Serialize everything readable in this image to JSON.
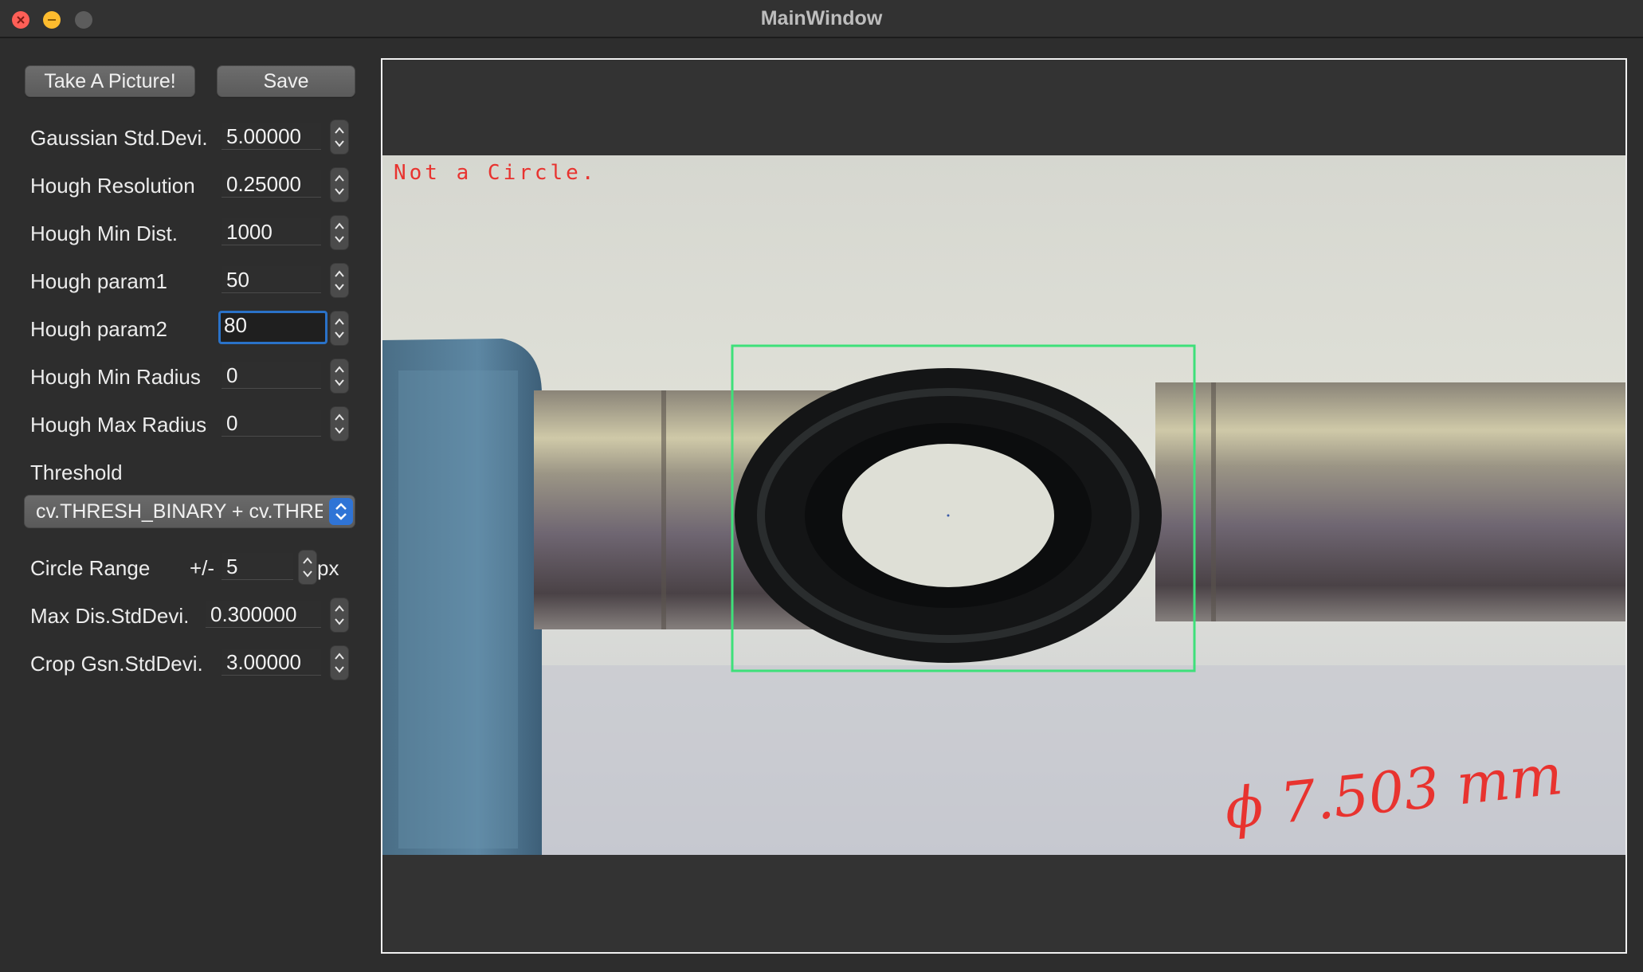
{
  "window": {
    "title": "MainWindow"
  },
  "toolbar": {
    "take_picture_label": "Take A Picture!",
    "save_label": "Save"
  },
  "params": [
    {
      "label": "Gaussian Std.Devi.",
      "value": "5.00000"
    },
    {
      "label": "Hough Resolution",
      "value": "0.25000"
    },
    {
      "label": "Hough Min Dist.",
      "value": "1000"
    },
    {
      "label": "Hough param1",
      "value": "50"
    },
    {
      "label": "Hough param2",
      "value": "80"
    },
    {
      "label": "Hough Min Radius",
      "value": "0"
    },
    {
      "label": "Hough Max Radius",
      "value": "0"
    }
  ],
  "threshold": {
    "label": "Threshold",
    "selected": "cv.THRESH_BINARY + cv.THRESH_OTSU"
  },
  "circle_range": {
    "label": "Circle Range",
    "prefix": "+/-",
    "value": "5",
    "unit": "px"
  },
  "max_dis": {
    "label": "Max Dis.StdDevi.",
    "value": "0.300000"
  },
  "crop": {
    "label": "Crop Gsn.StdDevi.",
    "value": "3.00000"
  },
  "preview": {
    "overlay_text": "Not a Circle.",
    "handwritten_note": "ϕ 7.503 mm",
    "overlay_color": "#e8332f",
    "detection_box_color": "#3ee07a"
  }
}
